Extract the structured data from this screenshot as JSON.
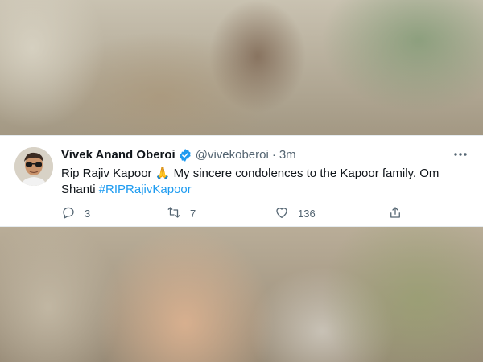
{
  "tweet": {
    "author_name": "Vivek Anand Oberoi",
    "handle": "@vivekoberoi",
    "separator": "·",
    "time": "3m",
    "text_part1": "Rip Rajiv Kapoor 🙏 My sincere condolences to the Kapoor family. Om Shanti ",
    "hashtag": "#RIPRajivKapoor",
    "replies": "3",
    "retweets": "7",
    "likes": "136",
    "verified": true
  },
  "icons": {
    "verified": "verified-badge-icon",
    "more": "more-dots-icon",
    "reply": "reply-icon",
    "retweet": "retweet-icon",
    "like": "heart-icon",
    "share": "share-icon"
  },
  "colors": {
    "verified": "#1d9bf0",
    "hashtag": "#1d9bf0",
    "secondary_text": "#536471",
    "primary_text": "#0f1419"
  }
}
